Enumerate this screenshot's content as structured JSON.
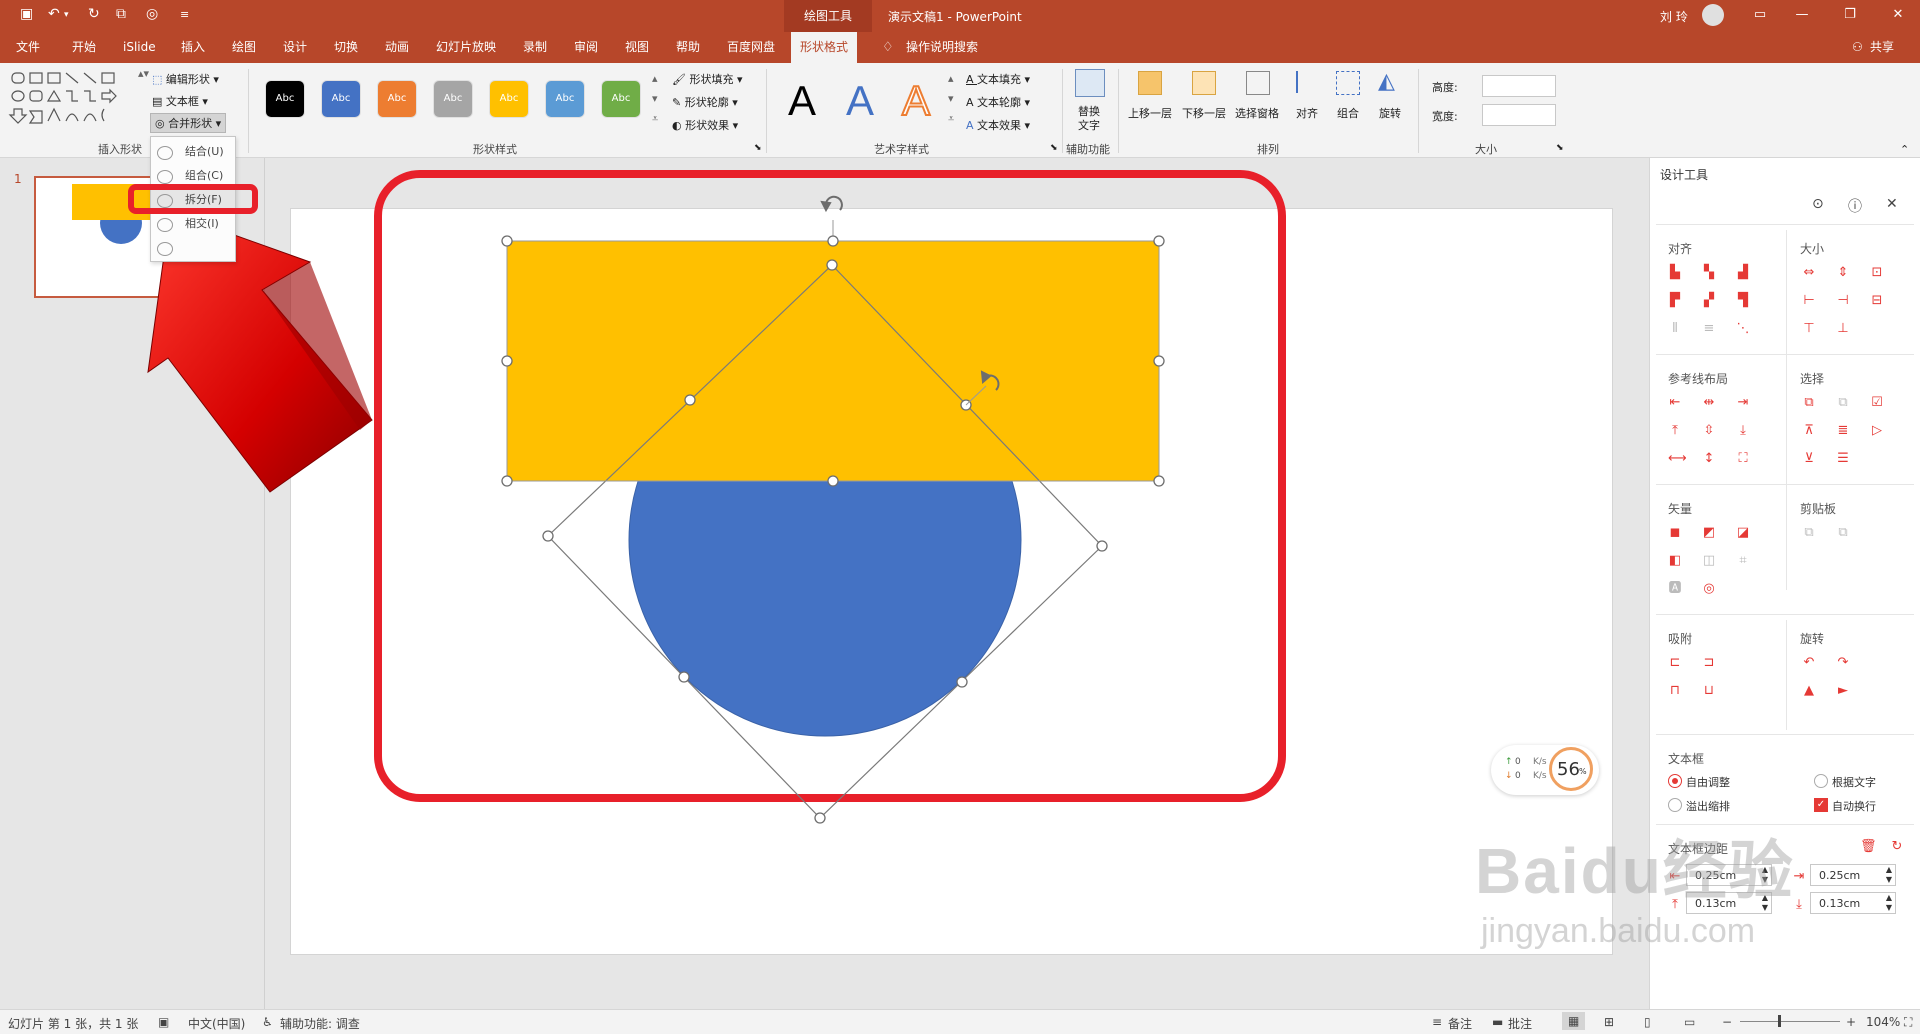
{
  "titlebar": {
    "context_tab_title": "绘图工具",
    "document_title": "演示文稿1  -  PowerPoint",
    "user_name": "刘 玲"
  },
  "tabs": [
    "文件",
    "开始",
    "iSlide",
    "插入",
    "绘图",
    "设计",
    "切换",
    "动画",
    "幻灯片放映",
    "录制",
    "审阅",
    "视图",
    "帮助",
    "百度网盘"
  ],
  "active_tab": "形状格式",
  "tell_me": "操作说明搜索",
  "share": "共享",
  "ribbon": {
    "insert_shapes": {
      "label": "插入形状",
      "edit_shape": "编辑形状",
      "textbox": "文本框",
      "merge_shapes": "合并形状"
    },
    "shape_styles": {
      "label": "形状样式",
      "swatch_text": "Abc",
      "swatch_colors": [
        "#000000",
        "#4472c4",
        "#ed7d31",
        "#a5a5a5",
        "#ffc000",
        "#5b9bd5",
        "#70ad47"
      ],
      "fill": "形状填充",
      "outline": "形状轮廓",
      "effects": "形状效果"
    },
    "wordart": {
      "label": "艺术字样式",
      "letter": "A",
      "text_fill": "文本填充",
      "text_outline": "文本轮廓",
      "text_effects": "文本效果"
    },
    "accessibility": {
      "label": "辅助功能",
      "alt_text_line1": "替换",
      "alt_text_line2": "文字"
    },
    "arrange": {
      "label": "排列",
      "bring_forward": "上移一层",
      "send_backward": "下移一层",
      "selection_pane": "选择窗格",
      "align": "对齐",
      "group": "组合",
      "rotate": "旋转"
    },
    "size": {
      "label": "大小",
      "height": "高度:",
      "width": "宽度:"
    }
  },
  "merge_menu": {
    "items": [
      "结合(U)",
      "组合(C)",
      "拆分(F)",
      "相交(I)"
    ],
    "highlighted": "拆分(F)"
  },
  "thumbnail": {
    "number": "1"
  },
  "design_pane": {
    "title": "设计工具",
    "sections": {
      "align": "对齐",
      "size": "大小",
      "guides": "参考线布局",
      "select": "选择",
      "vector": "矢量",
      "clipboard": "剪贴板",
      "snap": "吸附",
      "rotate": "旋转",
      "textbox": "文本框",
      "margins": "文本框边距"
    },
    "textbox_options": {
      "auto_fit": "自由调整",
      "fit_text": "根据文字",
      "overflow": "溢出缩排",
      "wrap": "自动换行"
    },
    "margins": {
      "left": "0.25cm",
      "right": "0.25cm",
      "top": "0.13cm",
      "bottom": "0.13cm"
    }
  },
  "net_widget": {
    "up": "0",
    "down": "0",
    "unit": "K/s",
    "percent": "56",
    "percent_sign": "%"
  },
  "statusbar": {
    "slide_info": "幻灯片 第 1 张，共 1 张",
    "language": "中文(中国)",
    "accessibility": "辅助功能: 调查",
    "notes": "备注",
    "comments": "批注",
    "zoom": "104%"
  },
  "watermark": {
    "brand": "Baidu经验",
    "url": "jingyan.baidu.com"
  },
  "colors": {
    "brand": "#b7472a",
    "accent_red": "#e53935",
    "rect_fill": "#ffc000",
    "circle_fill": "#4472c4",
    "highlight_box": "#e8202a"
  }
}
